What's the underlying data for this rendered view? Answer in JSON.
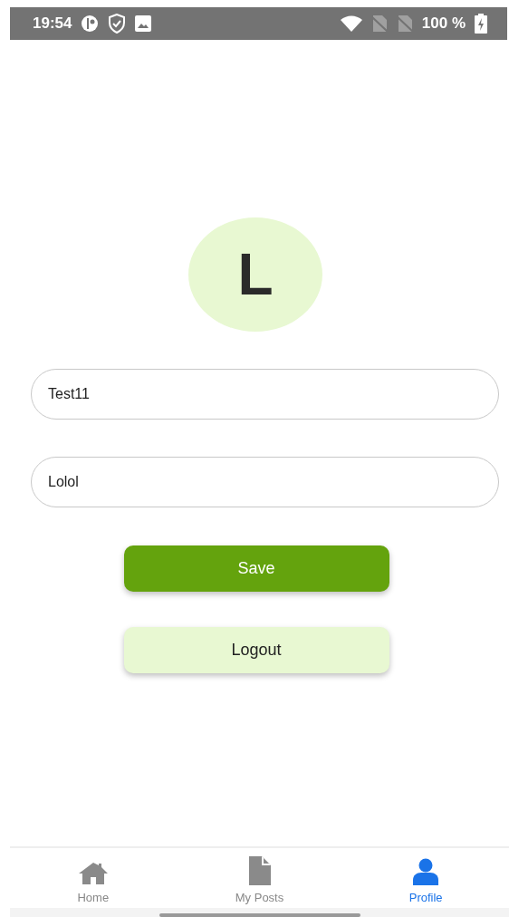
{
  "status_bar": {
    "time": "19:54",
    "battery": "100 %"
  },
  "avatar": {
    "initial": "L"
  },
  "fields": [
    {
      "value": "Test11"
    },
    {
      "value": "Lolol"
    }
  ],
  "buttons": [
    {
      "label": "Save",
      "kind": "primary"
    },
    {
      "label": "Logout",
      "kind": "secondary"
    }
  ],
  "tabs": [
    {
      "label": "Home",
      "kind": "home",
      "selected": false
    },
    {
      "label": "My Posts",
      "kind": "file",
      "selected": false
    },
    {
      "label": "Profile",
      "kind": "person",
      "selected": true
    }
  ]
}
